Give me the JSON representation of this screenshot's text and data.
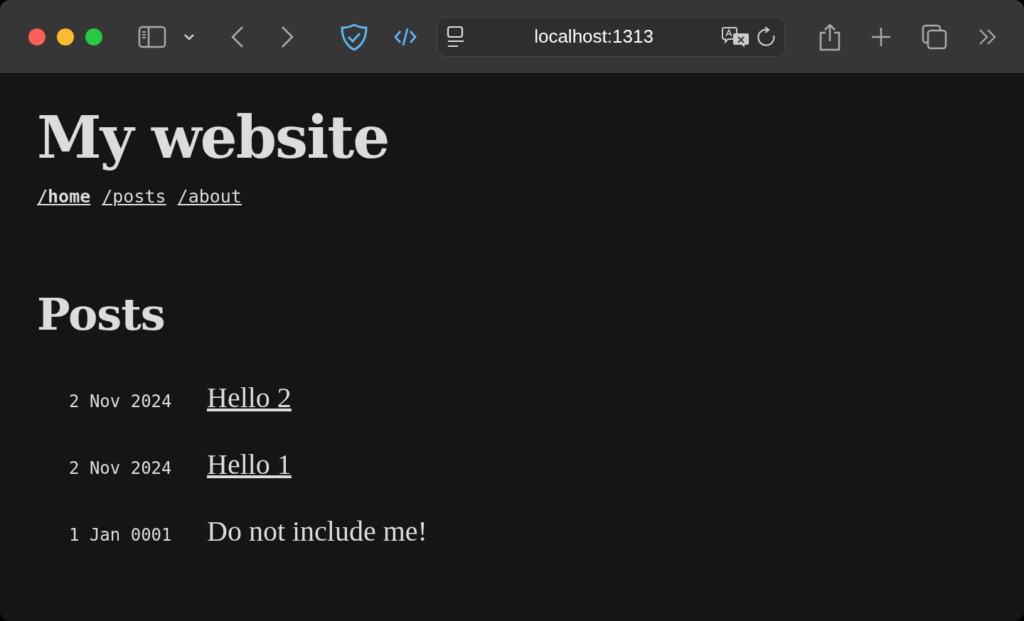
{
  "browser": {
    "address": "localhost:1313"
  },
  "site": {
    "title": "My website",
    "nav": [
      {
        "label": "/home",
        "current": true
      },
      {
        "label": "/posts",
        "current": false
      },
      {
        "label": "/about",
        "current": false
      }
    ]
  },
  "section": {
    "heading": "Posts"
  },
  "posts": [
    {
      "date": "2 Nov 2024",
      "title": "Hello 2",
      "kind": "link"
    },
    {
      "date": "2 Nov 2024",
      "title": "Hello 1",
      "kind": "link"
    },
    {
      "date": "1 Jan 0001",
      "title": "Do not include me!",
      "kind": "plain"
    }
  ]
}
